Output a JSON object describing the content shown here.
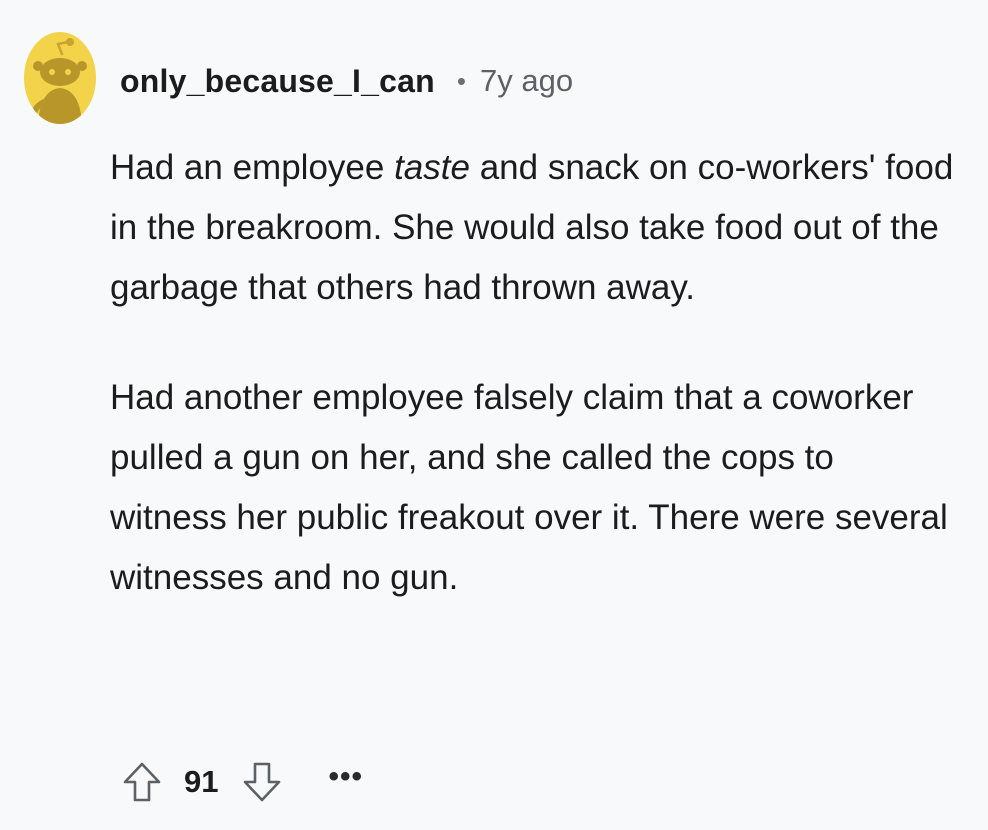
{
  "comment": {
    "author": "only_because_I_can",
    "separator": "•",
    "age": "7y ago",
    "paragraph1": {
      "before": "Had an employee ",
      "emphasis": "taste",
      "after": " and snack on co-workers' food in the breakroom. She would also take food out of the garbage that others had thrown away."
    },
    "paragraph2": "Had another employee falsely claim that a coworker pulled a gun on her, and she called the cops to witness her public freakout over it. There were several witnesses and no gun.",
    "score": "91",
    "more_label": "•••"
  },
  "icons": {
    "avatar": "snoo-avatar-icon",
    "upvote": "arrow-up-outline-icon",
    "downvote": "arrow-down-outline-icon",
    "more": "ellipsis-icon"
  },
  "colors": {
    "background": "#f8f9fa",
    "avatar_bg": "#f2d34a",
    "text": "#1c1c1c",
    "meta": "#5c6165"
  }
}
